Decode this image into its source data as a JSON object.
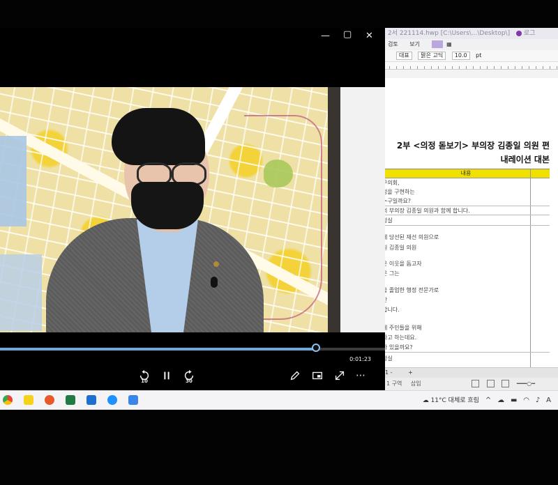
{
  "doc": {
    "title_bar": "2서 221114.hwp [C:\\Users\\...\\Desktop\\]",
    "title_bar_right": "로그",
    "menu": [
      "검토",
      "보기"
    ],
    "font_name": "맑은 고딕",
    "style_name": "대표",
    "font_size": "10.0",
    "font_unit": "pt",
    "title_line1": "2부 <의정 돋보기> 부의장 김종일 의원 편",
    "title_line2": "내레이션 대본",
    "table_header": "내용",
    "rows": [
      "구의회,",
      "정을 구현하는",
      "누구일까요?",
      "의 부의장 김종일 의원과 함께 합니다.",
      "청실",
      "에 당선된 재선 의원으로",
      "원 김종일 의원",
      "운 이웃을 돕고자",
      "은 그는",
      "을 졸업한 행정 전문가로",
      "만",
      "합니다.",
      "데 주민들을 위해",
      "다고 하는데요.",
      "가 있을까요?",
      "청실"
    ],
    "tab_label": "1 -",
    "status_text": "1 구역",
    "status_mode": "삽입"
  },
  "player": {
    "time": "0:01:23",
    "progress": 0.82,
    "rewind_label": "10",
    "forward_label": "30"
  },
  "taskbar": {
    "weather": "11°C 대체로 흐림"
  },
  "colors": {
    "seek_accent": "#6fa8dc",
    "doc_header_yellow": "#f0e000"
  }
}
